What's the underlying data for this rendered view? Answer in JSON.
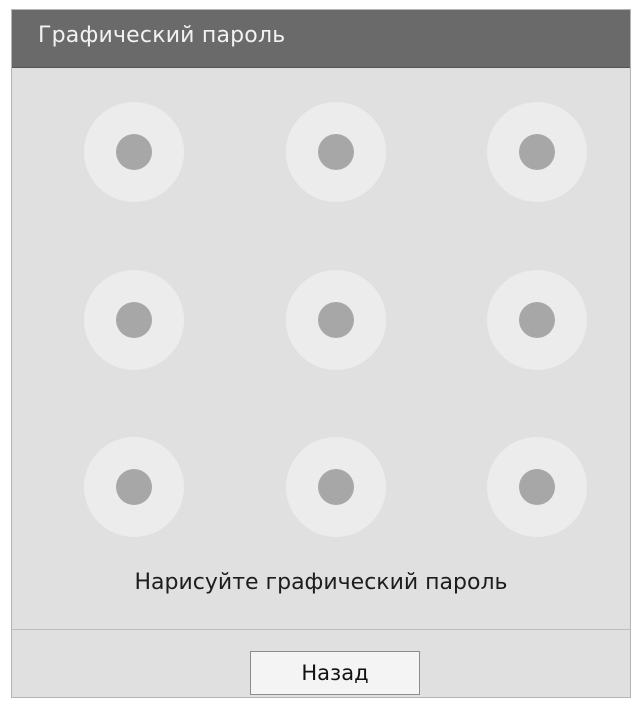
{
  "dialog": {
    "title": "Графический пароль",
    "prompt": "Нарисуйте графический пароль",
    "back_label": "Назад"
  },
  "pattern": {
    "rows": 3,
    "cols": 3,
    "selected": []
  },
  "colors": {
    "titlebar": "#6a6a6a",
    "background": "#e0e0e0",
    "node_ring": "#ececec",
    "node_dot": "#a7a7a7"
  }
}
